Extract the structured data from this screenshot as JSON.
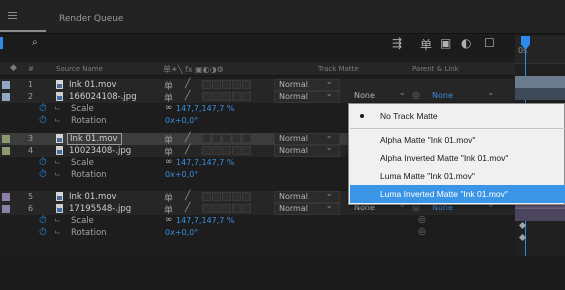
{
  "panel": {
    "title": "Render Queue"
  },
  "search": {
    "placeholder": ""
  },
  "timeline": {
    "time_label": "0s"
  },
  "header": {
    "number_col": "#",
    "source_name": "Source Name",
    "switch_icons": "单✴╲ fx ▣◐◑⚙",
    "track_matte": "Track Matte",
    "parent_link": "Parent & Link"
  },
  "layers": [
    {
      "num": "1",
      "name": "Ink 01.mov",
      "type": "footage",
      "color": "#8fa7bf",
      "mode": "Normal",
      "track_matte": "",
      "parent": "None"
    },
    {
      "num": "2",
      "name": "166024108-.jpg",
      "type": "image",
      "color": "#8fa7bf",
      "mode": "Normal",
      "track_matte": "None",
      "parent": "None"
    },
    {
      "num": "3",
      "name": "Ink 01.mov",
      "type": "footage",
      "color": "#8c9a74",
      "mode": "Normal",
      "track_matte": "",
      "parent": "None",
      "selected": true
    },
    {
      "num": "4",
      "name": "10023408-.jpg",
      "type": "image",
      "color": "#8c9a74",
      "mode": "Normal",
      "track_matte": "",
      "parent": "None"
    },
    {
      "num": "5",
      "name": "Ink 01.mov",
      "type": "footage",
      "color": "#8c80a6",
      "mode": "Normal",
      "track_matte": "",
      "parent": "None"
    },
    {
      "num": "6",
      "name": "17195548-.jpg",
      "type": "image",
      "color": "#8c80a6",
      "mode": "Normal",
      "track_matte": "None",
      "parent": "None"
    }
  ],
  "properties": {
    "scale_label": "Scale",
    "scale_value": "147,7,147,7 %",
    "rotation_label": "Rotation",
    "rotation_value": "0x+0,0°"
  },
  "track_matte_menu": {
    "items": [
      {
        "label": "No Track Matte",
        "checked": true
      },
      {
        "label": "Alpha Matte \"Ink 01.mov\""
      },
      {
        "label": "Alpha Inverted Matte \"Ink 01.mov\""
      },
      {
        "label": "Luma Matte \"Ink 01.mov\""
      },
      {
        "label": "Luma Inverted Matte \"Ink 01.mov\"",
        "highlighted": true
      }
    ]
  },
  "icons": {
    "menu": "hamburger-icon",
    "search": "search-icon",
    "layer_footage": "film-icon",
    "layer_image": "image-file-icon",
    "stopwatch": "stopwatch-icon",
    "graph": "graph-icon",
    "link": "chain-link-icon",
    "pickwhip": "pickwhip-icon"
  },
  "colors": {
    "accent": "#2d8ceb",
    "menu_highlight": "#3b95e6",
    "property_value": "#3b8ee0"
  }
}
